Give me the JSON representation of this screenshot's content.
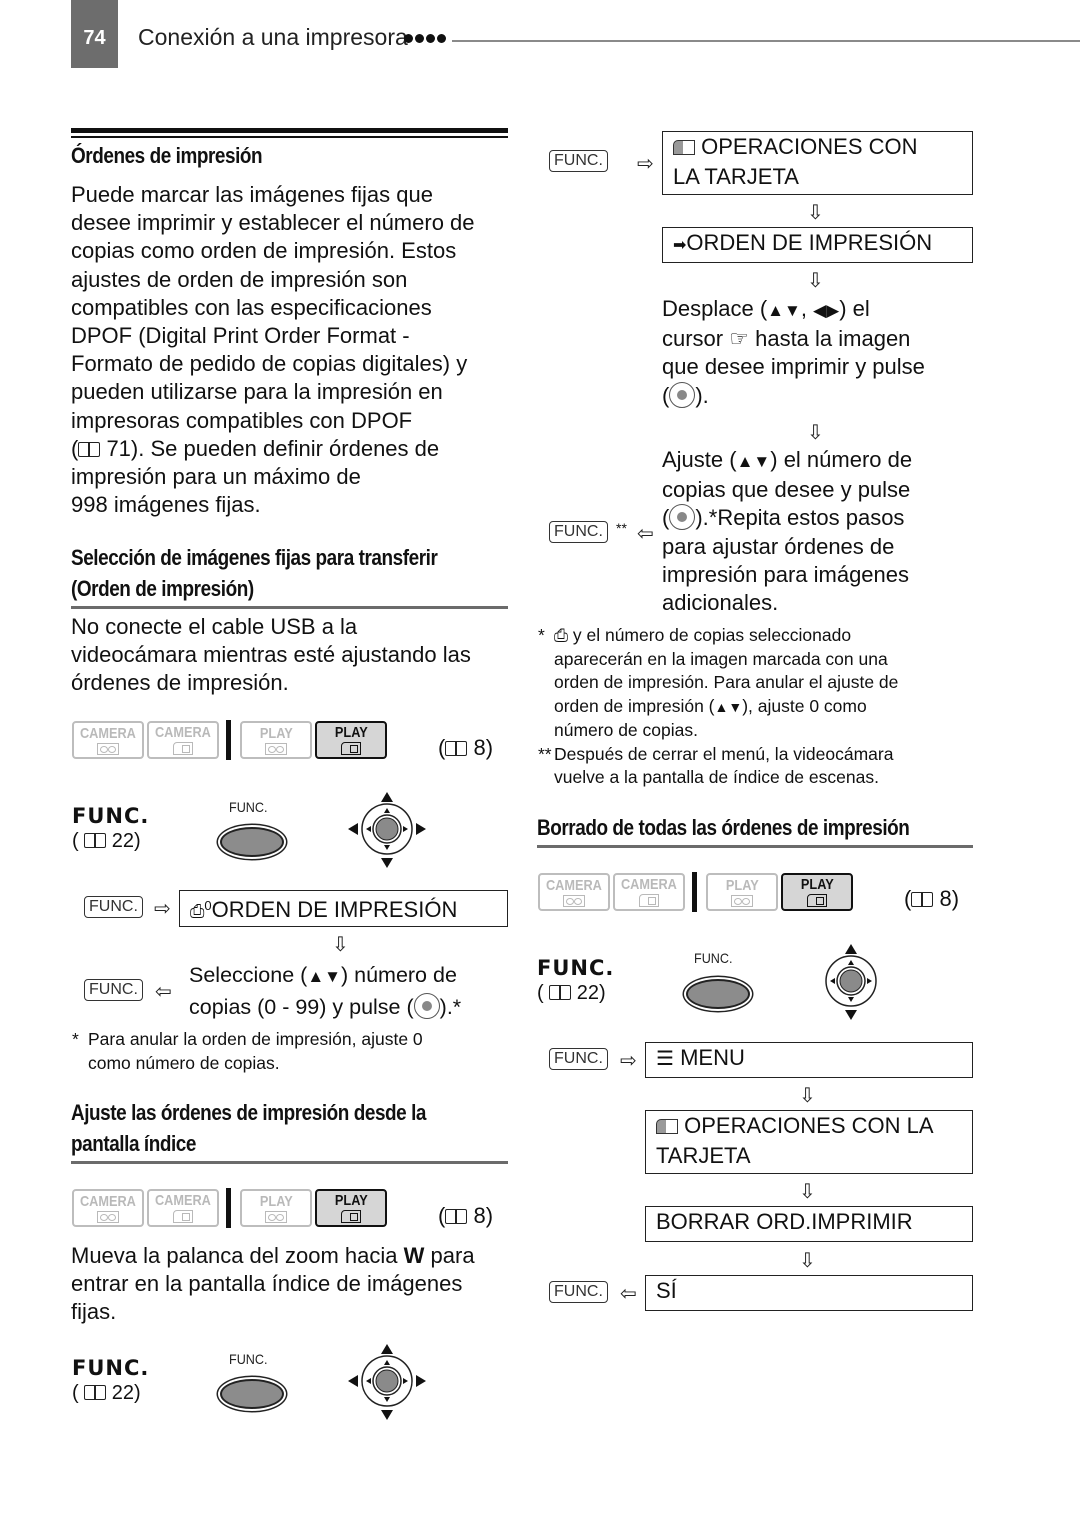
{
  "header": {
    "page_number": "74",
    "title": "Conexión a una impresora"
  },
  "left": {
    "section1": {
      "title": "Órdenes de impresión",
      "body": [
        "Puede marcar las imágenes fijas que",
        "desee imprimir y establecer el número de",
        "copias como orden de impresión. Estos",
        "ajustes de orden de impresión son",
        "compatibles con las especificaciones",
        "DPOF (Digital Print Order Format -",
        "Formato de pedido de copias digitales) y",
        "pueden utilizarse para la impresión en",
        "impresoras compatibles con DPOF",
        " 71). Se pueden definir órdenes de",
        "impresión para un máximo de",
        "998 imágenes fijas."
      ]
    },
    "section2": {
      "title_lines": [
        "Selección de imágenes fijas para transferir",
        "(Orden de impresión)"
      ],
      "body": [
        "No conecte el cable USB a la",
        "videocámara mientras esté ajustando las",
        "órdenes de impresión."
      ],
      "mode_ref": "8",
      "func_label": "FUNC.",
      "func_ref": "22",
      "func_button_label": "FUNC.",
      "step1_key": "FUNC.",
      "step1_box": "ORDEN DE IMPRESIÓN",
      "step1_icon_sup": "0",
      "step2_key": "FUNC.",
      "step2_line1_pre": "Seleccione (",
      "step2_line1_post": ") número de",
      "step2_line2_pre": "copias (0 - 99) y pulse (",
      "step2_line2_post": ").*",
      "footnote_mark": "*",
      "footnote": [
        "Para anular la orden de impresión, ajuste 0",
        "como número de copias."
      ]
    },
    "section3": {
      "title_lines": [
        "Ajuste las órdenes de impresión desde la",
        "pantalla índice"
      ],
      "mode_ref": "8",
      "body_pre": "Mueva la palanca del zoom hacia ",
      "body_bold": "W",
      "body_post": " para",
      "body_lines": [
        "entrar en la pantalla índice de imágenes",
        "fijas."
      ],
      "func_label": "FUNC.",
      "func_ref": "22",
      "func_button_label": "FUNC."
    }
  },
  "modes": [
    {
      "label": "CAMERA",
      "media": "tape",
      "active": false
    },
    {
      "label": "CAMERA",
      "media": "card",
      "active": false
    },
    {
      "label": "PLAY",
      "media": "tape",
      "active": false
    },
    {
      "label": "PLAY",
      "media": "card",
      "active": true
    }
  ],
  "right": {
    "flow1": {
      "key1": "FUNC.",
      "box1_line1": "OPERACIONES CON",
      "box1_line2": "LA TARJETA",
      "box2": "ORDEN DE IMPRESIÓN",
      "desplace": {
        "l1_pre": "Desplace (",
        "l1_mid": ", ",
        "l1_post": ") el",
        "l2_pre": "cursor ",
        "l2_post": " hasta la imagen",
        "l3": "que desee imprimir y pulse",
        "l4_pre": "(",
        "l4_post": ")."
      },
      "ajuste": {
        "l1_pre": "Ajuste (",
        "l1_post": ") el número de",
        "l2": "copias que desee y pulse",
        "l3_pre": "(",
        "l3_post": ").*Repita estos pasos",
        "l4": "para ajustar órdenes de",
        "l5": "impresión para imágenes",
        "l6": "adicionales."
      },
      "key2": "FUNC.",
      "key2_mark": "**"
    },
    "notes": {
      "n1_mark": "*",
      "n1_l1": "y el número de copias seleccionado",
      "n1_l2": "aparecerán en la imagen marcada con una",
      "n1_l3": "orden de impresión. Para anular el ajuste de",
      "n1_l4_pre": "orden de impresión (",
      "n1_l4_post": "), ajuste 0 como",
      "n1_l5": "número de copias.",
      "n2_mark": "**",
      "n2_l1": "Después de cerrar el menú, la videocámara",
      "n2_l2": "vuelve a la pantalla de índice de escenas."
    },
    "section4": {
      "title": "Borrado de todas las órdenes de impresión",
      "mode_ref": "8",
      "func_label": "FUNC.",
      "func_ref": "22",
      "func_button_label": "FUNC.",
      "key1": "FUNC.",
      "box1": "MENU",
      "box2_line1": "OPERACIONES CON LA",
      "box2_line2": "TARJETA",
      "box3": "BORRAR ORD.IMPRIMIR",
      "key2": "FUNC.",
      "box4": "SÍ"
    }
  },
  "glyphs": {
    "updown": "▲▼",
    "leftright": "◀▶",
    "arrow_right": "⇨",
    "arrow_left": "⇦",
    "arrow_down": "⇩",
    "arrow_bold": "➡",
    "hand": "☞",
    "printer": "⎙"
  }
}
